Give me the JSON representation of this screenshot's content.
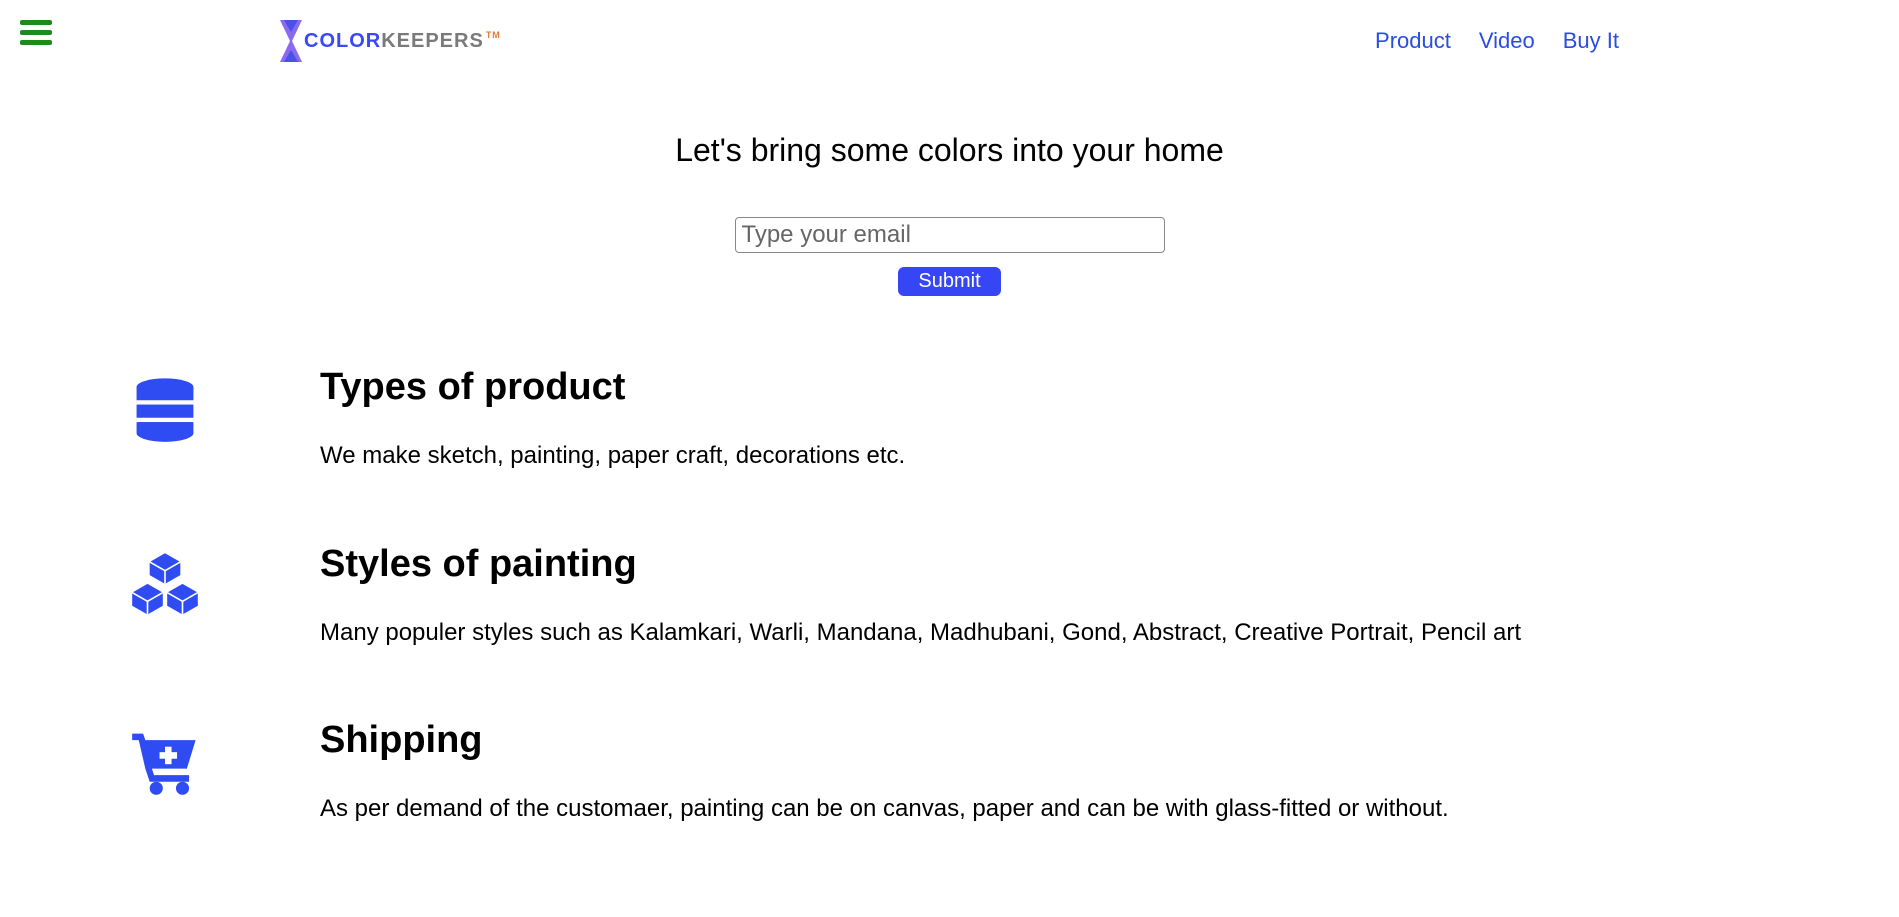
{
  "brand": {
    "name_part1": "COLOR",
    "name_part2": "KEEPERS",
    "tm": "TM"
  },
  "nav": {
    "product": "Product",
    "video": "Video",
    "buy": "Buy It"
  },
  "hero": {
    "title": "Let's bring some colors into your home",
    "email_placeholder": "Type your email",
    "submit_label": "Submit"
  },
  "features": [
    {
      "title": "Types of product",
      "desc": "We make sketch, painting, paper craft, decorations etc."
    },
    {
      "title": "Styles of painting",
      "desc": "Many populer styles such as Kalamkari, Warli, Mandana, Madhubani, Gond, Abstract, Creative Portrait, Pencil art"
    },
    {
      "title": "Shipping",
      "desc": "As per demand of the customaer, painting can be on canvas, paper and can be with glass-fitted or without."
    }
  ]
}
